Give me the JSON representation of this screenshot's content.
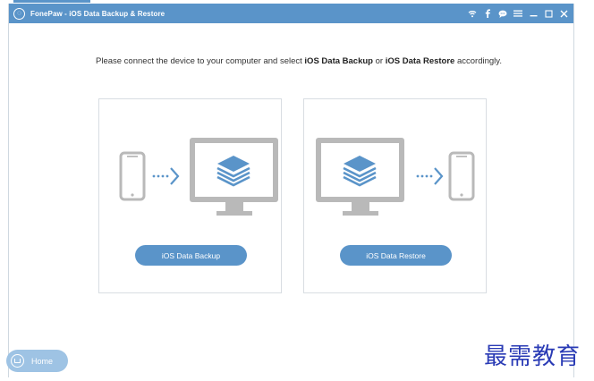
{
  "window": {
    "title": "FonePaw - iOS Data Backup & Restore",
    "logo_glyph": "◌"
  },
  "title_icons": [
    "wifi-icon",
    "facebook-icon",
    "chat-icon",
    "menu-icon",
    "minimize-icon",
    "maximize-icon",
    "close-icon"
  ],
  "instruction": {
    "part1": "Please connect the device to your computer and select ",
    "bold1": "iOS Data Backup",
    "part2": " or ",
    "bold2": "iOS Data Restore",
    "part3": " accordingly."
  },
  "cards": {
    "backup": {
      "button_label": "iOS Data Backup"
    },
    "restore": {
      "button_label": "iOS Data Restore"
    }
  },
  "home": {
    "label": "Home"
  },
  "watermark": {
    "text": "最需教育"
  },
  "colors": {
    "accent": "#5a94c9",
    "device_gray": "#b9b9b9",
    "home_button": "#9ec3e4"
  }
}
